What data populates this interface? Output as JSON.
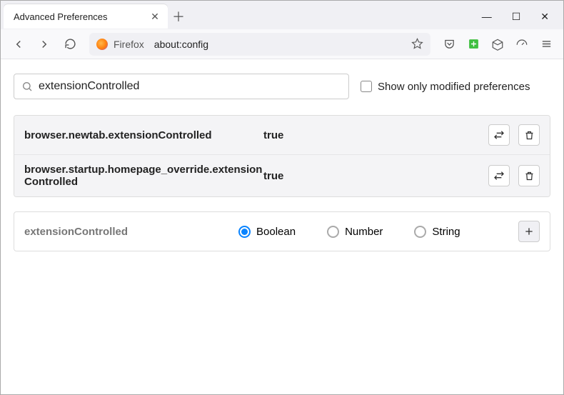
{
  "tab": {
    "title": "Advanced Preferences"
  },
  "urlbar": {
    "brand": "Firefox",
    "url": "about:config"
  },
  "search": {
    "value": "extensionControlled",
    "checkbox_label": "Show only modified preferences"
  },
  "prefs": [
    {
      "name": "browser.newtab.extensionControlled",
      "value": "true"
    },
    {
      "name": "browser.startup.homepage_override.extensionControlled",
      "value": "true"
    }
  ],
  "add": {
    "name": "extensionControlled",
    "types": [
      "Boolean",
      "Number",
      "String"
    ],
    "selected": "Boolean"
  }
}
